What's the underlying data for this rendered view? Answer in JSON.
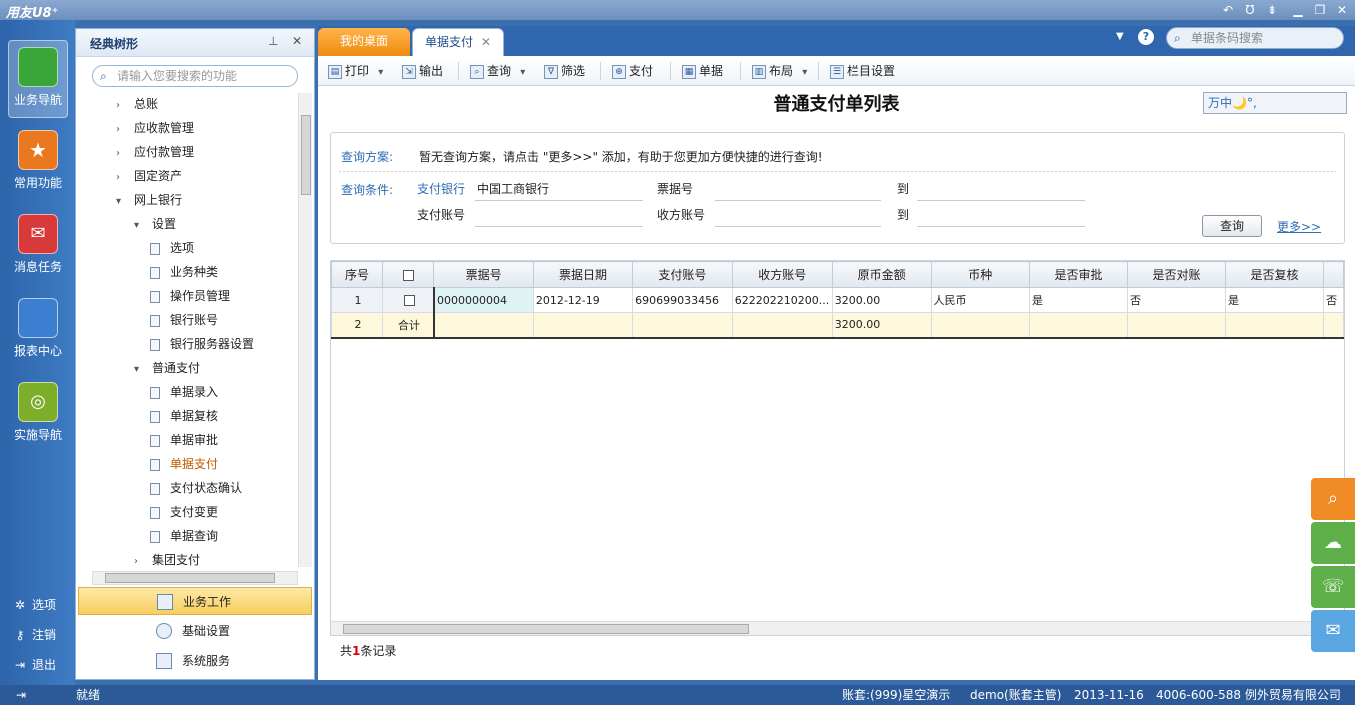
{
  "app": {
    "brand": "用友U8⁺"
  },
  "leftnav": {
    "items": [
      {
        "label": "业务导航",
        "icon": "business-nav-icon",
        "color": "#3aa63a"
      },
      {
        "label": "常用功能",
        "icon": "star-icon",
        "color": "#e9781e"
      },
      {
        "label": "消息任务",
        "icon": "mail-icon",
        "color": "#d83a3a"
      },
      {
        "label": "报表中心",
        "icon": "report-icon",
        "color": "#3c7fd0"
      },
      {
        "label": "实施导航",
        "icon": "compass-icon",
        "color": "#7cae2a"
      }
    ],
    "bottom": [
      {
        "label": "选项",
        "icon": "gear-icon"
      },
      {
        "label": "注销",
        "icon": "key-icon"
      },
      {
        "label": "退出",
        "icon": "exit-icon"
      }
    ]
  },
  "tree": {
    "title": "经典树形",
    "search_placeholder": "请输入您要搜索的功能",
    "nodes": [
      {
        "label": "总账",
        "level": 0,
        "type": "collapsed"
      },
      {
        "label": "应收款管理",
        "level": 0,
        "type": "collapsed"
      },
      {
        "label": "应付款管理",
        "level": 0,
        "type": "collapsed"
      },
      {
        "label": "固定资产",
        "level": 0,
        "type": "collapsed"
      },
      {
        "label": "网上银行",
        "level": 0,
        "type": "expanded"
      },
      {
        "label": "设置",
        "level": 1,
        "type": "expanded"
      },
      {
        "label": "选项",
        "level": 2,
        "type": "leaf"
      },
      {
        "label": "业务种类",
        "level": 2,
        "type": "leaf"
      },
      {
        "label": "操作员管理",
        "level": 2,
        "type": "leaf"
      },
      {
        "label": "银行账号",
        "level": 2,
        "type": "leaf"
      },
      {
        "label": "银行服务器设置",
        "level": 2,
        "type": "leaf"
      },
      {
        "label": "普通支付",
        "level": 1,
        "type": "expanded"
      },
      {
        "label": "单据录入",
        "level": 2,
        "type": "leaf"
      },
      {
        "label": "单据复核",
        "level": 2,
        "type": "leaf"
      },
      {
        "label": "单据审批",
        "level": 2,
        "type": "leaf"
      },
      {
        "label": "单据支付",
        "level": 2,
        "type": "leaf",
        "selected": true
      },
      {
        "label": "支付状态确认",
        "level": 2,
        "type": "leaf"
      },
      {
        "label": "支付变更",
        "level": 2,
        "type": "leaf"
      },
      {
        "label": "单据查询",
        "level": 2,
        "type": "leaf"
      },
      {
        "label": "集团支付",
        "level": 1,
        "type": "collapsed"
      }
    ],
    "bottom_nav": [
      {
        "label": "业务工作",
        "active": true
      },
      {
        "label": "基础设置",
        "active": false
      },
      {
        "label": "系统服务",
        "active": false
      }
    ]
  },
  "tabs": [
    {
      "label": "我的桌面"
    },
    {
      "label": "单据支付"
    }
  ],
  "global_search_placeholder": "单据条码搜索",
  "toolbar": [
    {
      "label": "打印",
      "dropdown": true
    },
    {
      "label": "输出",
      "dropdown": false
    },
    {
      "label": "查询",
      "dropdown": true
    },
    {
      "label": "筛选",
      "dropdown": false
    },
    {
      "label": "支付",
      "dropdown": false
    },
    {
      "label": "单据",
      "dropdown": false
    },
    {
      "label": "布局",
      "dropdown": true
    },
    {
      "label": "栏目设置",
      "dropdown": false
    }
  ],
  "page": {
    "title": "普通支付单列表",
    "ime": "万中🌙°,"
  },
  "query": {
    "scheme_label": "查询方案:",
    "scheme_text": "暂无查询方案，请点击 \"更多>>\" 添加，有助于您更加方便快捷的进行查询!",
    "cond_label": "查询条件:",
    "f_bank_label": "支付银行",
    "f_bank_value": "中国工商银行",
    "f_billno_label": "票据号",
    "f_to1": "到",
    "f_account_label": "支付账号",
    "f_recv_label": "收方账号",
    "f_to2": "到",
    "query_btn": "查询",
    "more_link": "更多>>"
  },
  "grid": {
    "columns": [
      "序号",
      "",
      "票据号",
      "票据日期",
      "支付账号",
      "收方账号",
      "原币金额",
      "币种",
      "是否审批",
      "是否对账",
      "是否复核",
      ""
    ],
    "rows": [
      [
        "1",
        "",
        "0000000004",
        "2012-12-19",
        "690699033456",
        "622202210200...",
        "3200.00",
        "人民币",
        "是",
        "否",
        "是",
        "否"
      ],
      [
        "2",
        "合计",
        "",
        "",
        "",
        "",
        "3200.00",
        "",
        "",
        "",
        "",
        ""
      ]
    ]
  },
  "records": {
    "prefix": "共",
    "count": "1",
    "suffix": "条记录"
  },
  "status": {
    "ready": "就绪",
    "account": "账套:(999)星空演示",
    "user": "demo(账套主管)",
    "date": "2013-11-16",
    "company": "4006-600-588 例外贸易有限公司"
  }
}
